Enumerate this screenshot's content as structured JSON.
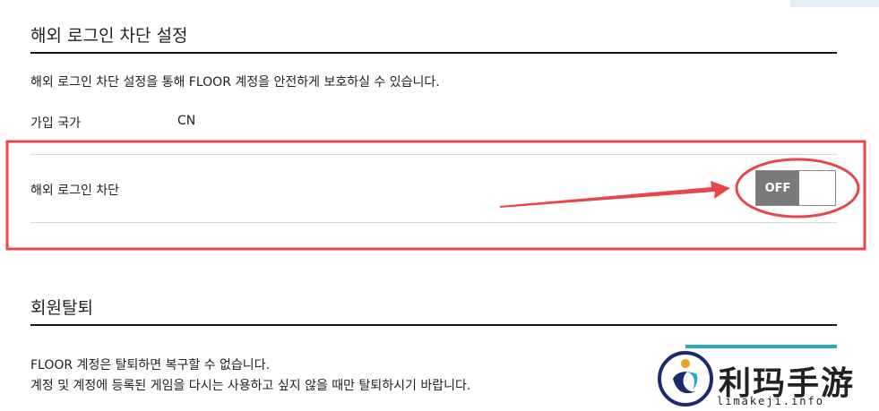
{
  "overseas_section": {
    "title": "해외 로그인 차단 설정",
    "description": "해외 로그인 차단 설정을 통해 FLOOR 계정을 안전하게 보호하실 수 있습니다.",
    "country_label": "가입 국가",
    "country_value": "CN",
    "block_label": "해외 로그인 차단",
    "toggle_state": "OFF"
  },
  "withdraw_section": {
    "title": "회원탈퇴",
    "line1": "FLOOR 계정은 탈퇴하면 복구할 수 없습니다.",
    "line2": "계정 및 계정에 등록된 게임을 다시는 사용하고 싶지 않을 때만 탈퇴하시기 바랍니다."
  },
  "watermark": {
    "text": "利玛手游",
    "url": "limakeji.info"
  },
  "colors": {
    "annotation_red": "#e8474a",
    "toggle_off": "#7a7a7a",
    "teal": "#29a9c7"
  }
}
